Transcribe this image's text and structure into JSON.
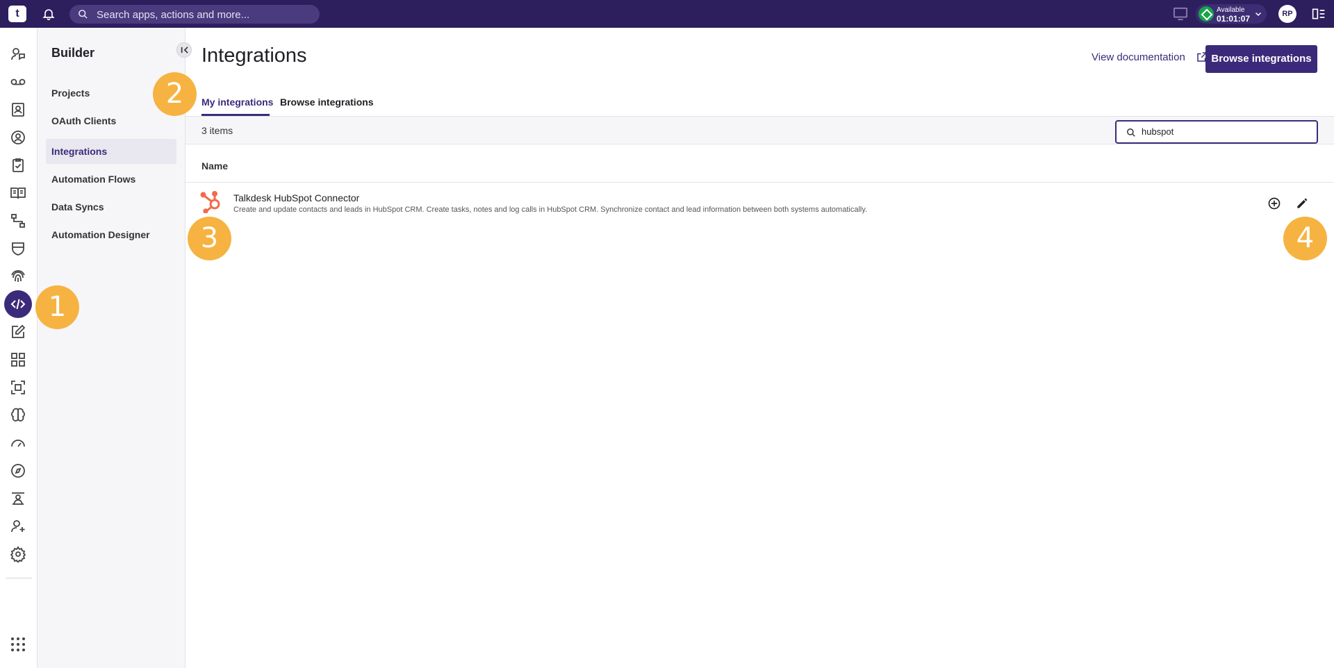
{
  "topbar": {
    "logo_text": "t",
    "search_placeholder": "Search apps, actions and more...",
    "status_label": "Available",
    "status_time": "01:01:07",
    "avatar_initials": "RP"
  },
  "rail": {
    "icons": [
      "chat-agent-icon",
      "voicemail-icon",
      "contacts-icon",
      "team-icon",
      "clipboard-icon",
      "knowledge-book-icon",
      "workflow-icon",
      "shield-icon",
      "fingerprint-icon",
      "code-icon",
      "edit-icon",
      "dashboard-grid-icon",
      "screen-capture-icon",
      "ai-brain-icon",
      "speedometer-icon",
      "compass-icon",
      "trainer-icon",
      "user-add-icon",
      "settings-icon",
      "app-launcher-icon"
    ],
    "active_icon": "code-icon"
  },
  "sidebar": {
    "title": "Builder",
    "items": [
      {
        "label": "Projects"
      },
      {
        "label": "OAuth Clients"
      },
      {
        "label": "Integrations"
      },
      {
        "label": "Automation Flows"
      },
      {
        "label": "Data Syncs"
      },
      {
        "label": "Automation Designer"
      }
    ]
  },
  "main": {
    "title": "Integrations",
    "doc_link": "View documentation",
    "browse_button": "Browse integrations",
    "tabs": [
      {
        "label": "My integrations"
      },
      {
        "label": "Browse integrations"
      }
    ],
    "count": "3 items",
    "search_value": "hubspot",
    "column_name": "Name",
    "rows": [
      {
        "title": "Talkdesk HubSpot Connector",
        "description": "Create and update contacts and leads in HubSpot CRM. Create tasks, notes and log calls in HubSpot CRM. Synchronize contact and lead information between both systems automatically."
      }
    ]
  },
  "callouts": [
    "1",
    "2",
    "3",
    "4"
  ],
  "colors": {
    "brand": "#2d1e5e",
    "accent": "#3b2a7a",
    "callout": "#f6b341",
    "hubspot": "#f26b4d",
    "status_available": "#17a34a"
  }
}
